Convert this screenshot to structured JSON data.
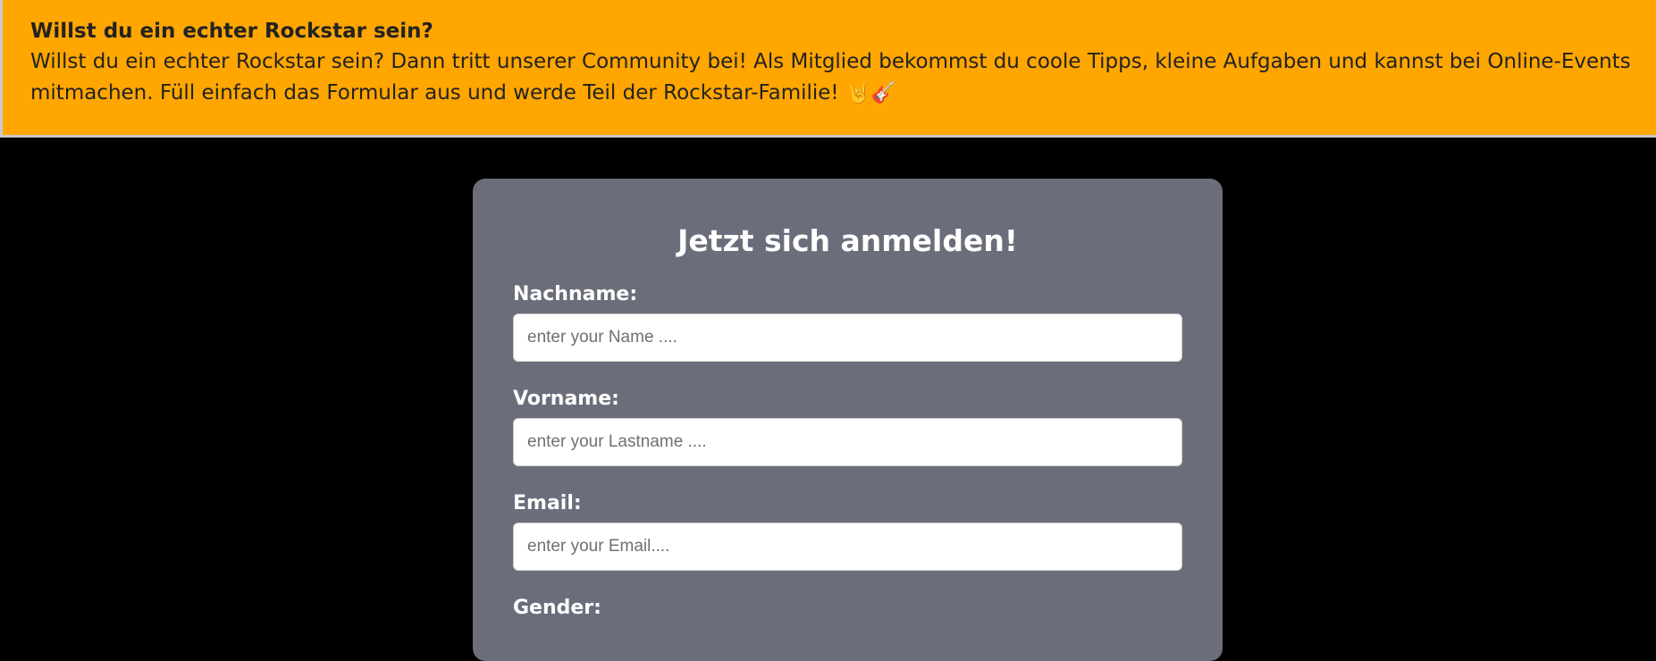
{
  "banner": {
    "title": "Willst du ein echter Rockstar sein?",
    "text": "Willst du ein echter Rockstar sein? Dann tritt unserer Community bei! Als Mitglied bekommst du coole Tipps, kleine Aufgaben und kannst bei Online-Events mitmachen. Füll einfach das Formular aus und werde Teil der Rockstar-Familie! 🤘🎸"
  },
  "form": {
    "title": "Jetzt sich anmelden!",
    "fields": [
      {
        "label": "Nachname:",
        "placeholder": "enter your Name ....",
        "value": ""
      },
      {
        "label": "Vorname:",
        "placeholder": "enter your Lastname ....",
        "value": ""
      },
      {
        "label": "Email:",
        "placeholder": "enter your Email....",
        "value": ""
      }
    ],
    "gender_label": "Gender:"
  },
  "colors": {
    "banner_background": "#ffa600",
    "page_background": "#000000",
    "card_background": "#6b6e7a"
  }
}
